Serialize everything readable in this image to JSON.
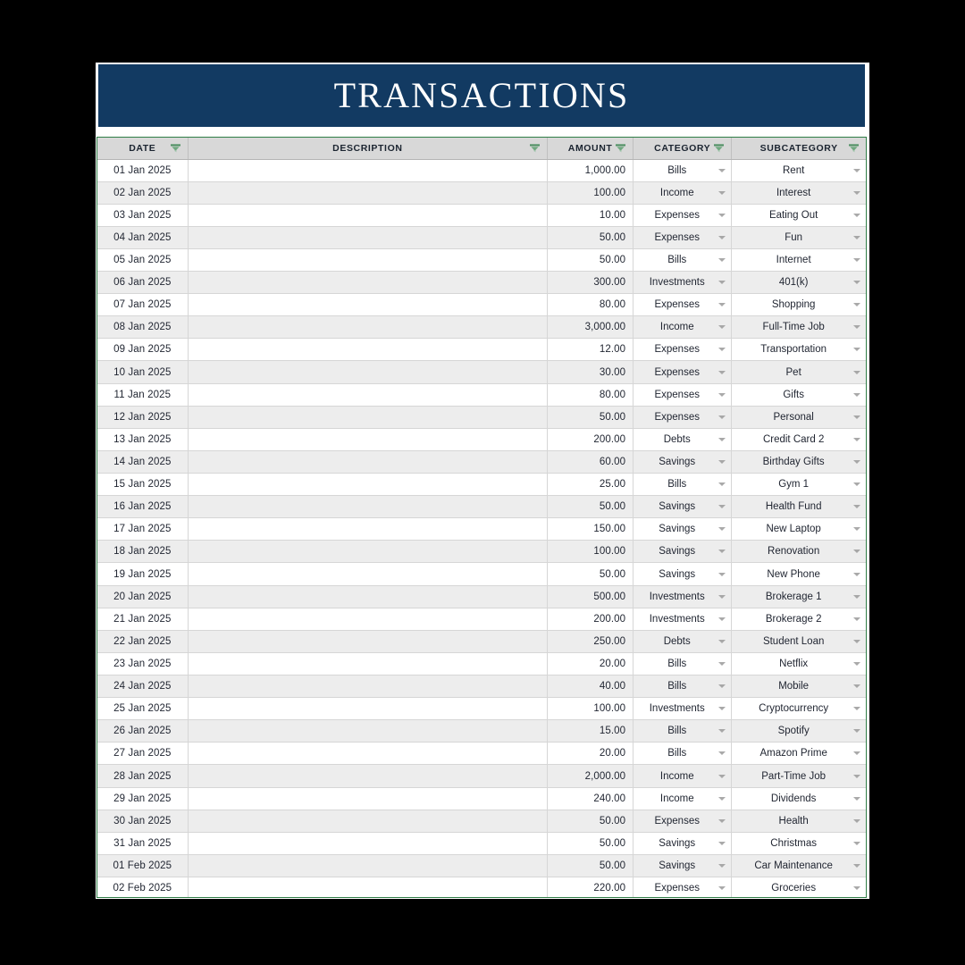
{
  "banner": {
    "title": "TRANSACTIONS",
    "bg_color": "#123A62",
    "text_color": "#FFFFFF"
  },
  "theme": {
    "border_color": "#2E7D46",
    "header_bg": "#D8D8D8",
    "row_alt_bg": "#EDEDED",
    "page_bg": "#000000"
  },
  "icons": {
    "filter": "filter-icon",
    "dropdown": "chevron-down-icon"
  },
  "table": {
    "columns": [
      {
        "key": "date",
        "label": "DATE",
        "filterable": true
      },
      {
        "key": "description",
        "label": "DESCRIPTION",
        "filterable": true
      },
      {
        "key": "amount",
        "label": "AMOUNT",
        "filterable": true
      },
      {
        "key": "category",
        "label": "CATEGORY",
        "filterable": true
      },
      {
        "key": "subcategory",
        "label": "SUBCATEGORY",
        "filterable": true
      }
    ],
    "rows": [
      {
        "date": "01 Jan 2025",
        "description": "",
        "amount": "1,000.00",
        "category": "Bills",
        "subcategory": "Rent"
      },
      {
        "date": "02 Jan 2025",
        "description": "",
        "amount": "100.00",
        "category": "Income",
        "subcategory": "Interest"
      },
      {
        "date": "03 Jan 2025",
        "description": "",
        "amount": "10.00",
        "category": "Expenses",
        "subcategory": "Eating Out"
      },
      {
        "date": "04 Jan 2025",
        "description": "",
        "amount": "50.00",
        "category": "Expenses",
        "subcategory": "Fun"
      },
      {
        "date": "05 Jan 2025",
        "description": "",
        "amount": "50.00",
        "category": "Bills",
        "subcategory": "Internet"
      },
      {
        "date": "06 Jan 2025",
        "description": "",
        "amount": "300.00",
        "category": "Investments",
        "subcategory": "401(k)"
      },
      {
        "date": "07 Jan 2025",
        "description": "",
        "amount": "80.00",
        "category": "Expenses",
        "subcategory": "Shopping"
      },
      {
        "date": "08 Jan 2025",
        "description": "",
        "amount": "3,000.00",
        "category": "Income",
        "subcategory": "Full-Time Job"
      },
      {
        "date": "09 Jan 2025",
        "description": "",
        "amount": "12.00",
        "category": "Expenses",
        "subcategory": "Transportation"
      },
      {
        "date": "10 Jan 2025",
        "description": "",
        "amount": "30.00",
        "category": "Expenses",
        "subcategory": "Pet"
      },
      {
        "date": "11 Jan 2025",
        "description": "",
        "amount": "80.00",
        "category": "Expenses",
        "subcategory": "Gifts"
      },
      {
        "date": "12 Jan 2025",
        "description": "",
        "amount": "50.00",
        "category": "Expenses",
        "subcategory": "Personal"
      },
      {
        "date": "13 Jan 2025",
        "description": "",
        "amount": "200.00",
        "category": "Debts",
        "subcategory": "Credit Card 2"
      },
      {
        "date": "14 Jan 2025",
        "description": "",
        "amount": "60.00",
        "category": "Savings",
        "subcategory": "Birthday Gifts"
      },
      {
        "date": "15 Jan 2025",
        "description": "",
        "amount": "25.00",
        "category": "Bills",
        "subcategory": "Gym 1"
      },
      {
        "date": "16 Jan 2025",
        "description": "",
        "amount": "50.00",
        "category": "Savings",
        "subcategory": "Health Fund"
      },
      {
        "date": "17 Jan 2025",
        "description": "",
        "amount": "150.00",
        "category": "Savings",
        "subcategory": "New Laptop"
      },
      {
        "date": "18 Jan 2025",
        "description": "",
        "amount": "100.00",
        "category": "Savings",
        "subcategory": "Renovation"
      },
      {
        "date": "19 Jan 2025",
        "description": "",
        "amount": "50.00",
        "category": "Savings",
        "subcategory": "New Phone"
      },
      {
        "date": "20 Jan 2025",
        "description": "",
        "amount": "500.00",
        "category": "Investments",
        "subcategory": "Brokerage 1"
      },
      {
        "date": "21 Jan 2025",
        "description": "",
        "amount": "200.00",
        "category": "Investments",
        "subcategory": "Brokerage 2"
      },
      {
        "date": "22 Jan 2025",
        "description": "",
        "amount": "250.00",
        "category": "Debts",
        "subcategory": "Student Loan"
      },
      {
        "date": "23 Jan 2025",
        "description": "",
        "amount": "20.00",
        "category": "Bills",
        "subcategory": "Netflix"
      },
      {
        "date": "24 Jan 2025",
        "description": "",
        "amount": "40.00",
        "category": "Bills",
        "subcategory": "Mobile"
      },
      {
        "date": "25 Jan 2025",
        "description": "",
        "amount": "100.00",
        "category": "Investments",
        "subcategory": "Cryptocurrency"
      },
      {
        "date": "26 Jan 2025",
        "description": "",
        "amount": "15.00",
        "category": "Bills",
        "subcategory": "Spotify"
      },
      {
        "date": "27 Jan 2025",
        "description": "",
        "amount": "20.00",
        "category": "Bills",
        "subcategory": "Amazon Prime"
      },
      {
        "date": "28 Jan 2025",
        "description": "",
        "amount": "2,000.00",
        "category": "Income",
        "subcategory": "Part-Time Job"
      },
      {
        "date": "29 Jan 2025",
        "description": "",
        "amount": "240.00",
        "category": "Income",
        "subcategory": "Dividends"
      },
      {
        "date": "30 Jan 2025",
        "description": "",
        "amount": "50.00",
        "category": "Expenses",
        "subcategory": "Health"
      },
      {
        "date": "31 Jan 2025",
        "description": "",
        "amount": "50.00",
        "category": "Savings",
        "subcategory": "Christmas"
      },
      {
        "date": "01 Feb 2025",
        "description": "",
        "amount": "50.00",
        "category": "Savings",
        "subcategory": "Car Maintenance"
      },
      {
        "date": "02 Feb 2025",
        "description": "",
        "amount": "220.00",
        "category": "Expenses",
        "subcategory": "Groceries"
      }
    ]
  }
}
